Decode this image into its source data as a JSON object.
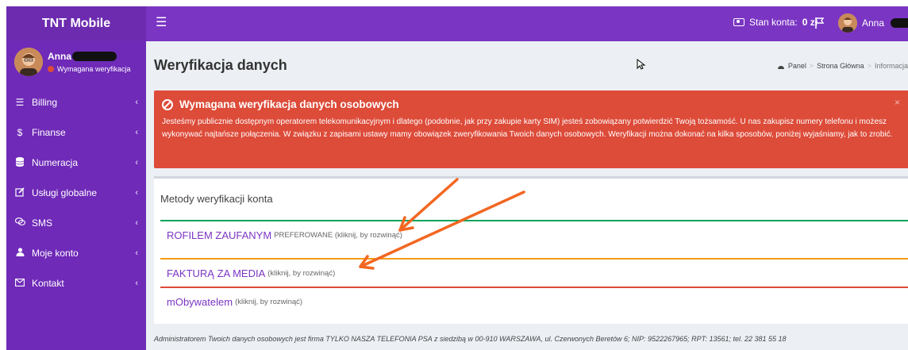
{
  "app": {
    "brand": "TNT Mobile"
  },
  "header": {
    "balance_label": "Stan konta:",
    "balance_value": "0 zł",
    "user_name": "Anna"
  },
  "sidebar": {
    "user_name": "Anna",
    "user_status": "Wymagana weryfikacja",
    "items": [
      {
        "label": "Billing",
        "icon": "list-icon"
      },
      {
        "label": "Finanse",
        "icon": "dollar-icon"
      },
      {
        "label": "Numeracja",
        "icon": "database-icon"
      },
      {
        "label": "Usługi globalne",
        "icon": "edit-icon"
      },
      {
        "label": "SMS",
        "icon": "chat-icon"
      },
      {
        "label": "Moje konto",
        "icon": "user-icon"
      },
      {
        "label": "Kontakt",
        "icon": "envelope-icon"
      }
    ]
  },
  "page": {
    "title": "Weryfikacja danych",
    "breadcrumb": [
      "Panel",
      "Strona Główna",
      "Informacja wstępna"
    ]
  },
  "alert": {
    "title": "Wymagana weryfikacja danych osobowych",
    "body": "Jesteśmy publicznie dostępnym operatorem telekomunikacyjnym i dlatego (podobnie, jak przy zakupie karty SIM) jesteś zobowiązany potwierdzić Twoją tożsamość. U nas zakupisz numery telefonu i możesz wykonywać najtańsze połączenia. W związku z zapisami ustawy mamy obowiązek zweryfikowania Twoich danych osobowych. Weryfikacji można dokonać na kilka sposobów, poniżej wyjaśniamy, jak to zrobić.",
    "close": "×"
  },
  "methods": {
    "title": "Metody weryfikacji konta",
    "items": [
      {
        "name": "ROFILEM ZAUFANYM",
        "suffix": "PREFEROWANE (kliknij, by rozwinąć)",
        "color": "#00a65a"
      },
      {
        "name": "FAKTURĄ ZA MEDIA",
        "suffix": "(kliknij, by rozwinąć)",
        "color": "#f39c12"
      },
      {
        "name": "mObywatelem",
        "suffix": "(kliknij, by rozwinąć)",
        "color": "#dd4b39"
      }
    ]
  },
  "footer": {
    "text": "Administratorem Twoich danych osobowych jest firma TYLKO NASZA TELEFONIA PSA z siedzibą w 00-910 WARSZAWA, ul. Czerwonych Beretów 6; NIP: 9522267965; RPT: 13561; tel. 22 381 55 18"
  },
  "colors": {
    "primary": "#7b35c3",
    "sidebar": "#6f2ab8",
    "danger": "#dd4b39",
    "arrow": "#f26722"
  }
}
